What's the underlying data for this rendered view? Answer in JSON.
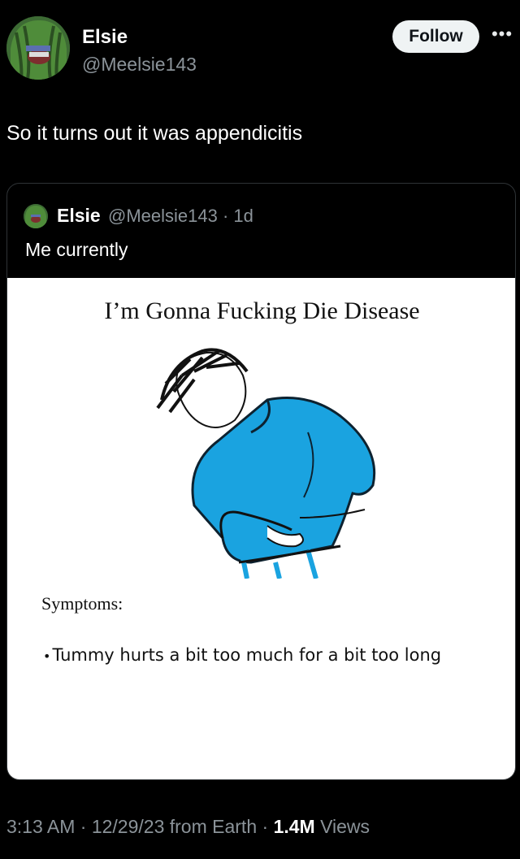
{
  "author": {
    "name": "Elsie",
    "handle": "@Meelsie143",
    "follow_label": "Follow",
    "more_icon": "ellipsis-icon"
  },
  "tweet": {
    "text": "So it turns out it was appendicitis"
  },
  "quote": {
    "name": "Elsie",
    "handle_time": "@Meelsie143 · 1d",
    "text": "Me currently",
    "image": {
      "title": "I’m Gonna Fucking Die Disease",
      "symptoms_label": "Symptoms:",
      "symptom_bullet": "•",
      "symptom": "Tummy hurts a bit too much for a bit too long",
      "shirt_color": "#1aa3e0"
    }
  },
  "meta": {
    "time_date_source": "3:13 AM · 12/29/23 from Earth · ",
    "views_count": "1.4M",
    "views_label": " Views"
  }
}
